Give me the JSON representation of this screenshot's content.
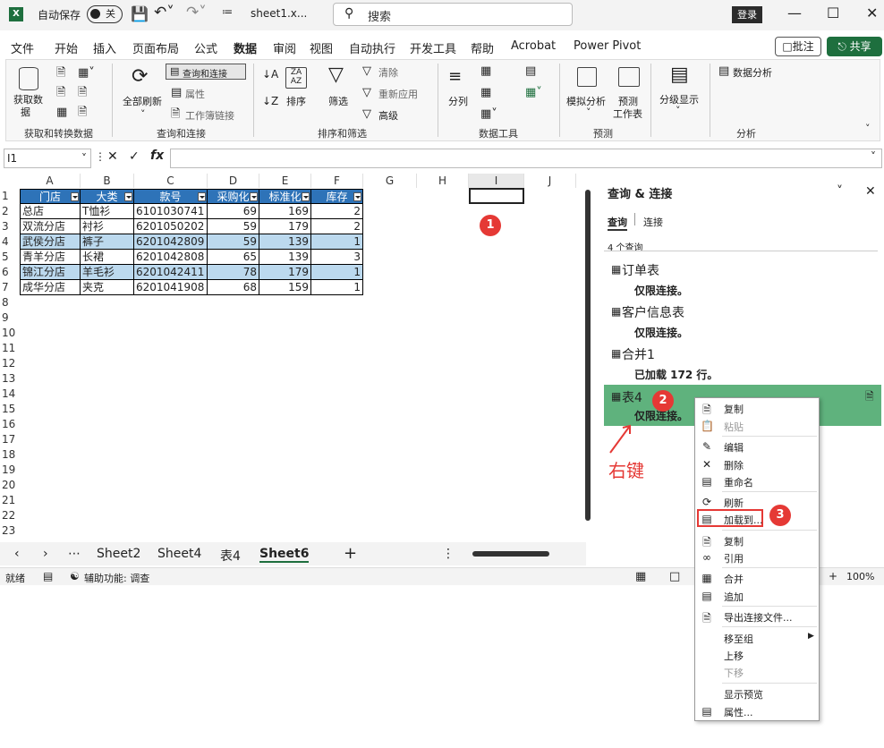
{
  "titlebar": {
    "autosave_label": "自动保存",
    "autosave_state": "关",
    "filename": "sheet1.x...",
    "search_placeholder": "搜索",
    "login": "登录"
  },
  "menu": [
    "文件",
    "开始",
    "插入",
    "页面布局",
    "公式",
    "数据",
    "审阅",
    "视图",
    "自动执行",
    "开发工具",
    "帮助",
    "Acrobat",
    "Power Pivot"
  ],
  "menu_active": "数据",
  "comment_btn": "批注",
  "share_btn": "共享",
  "ribbon": {
    "get_data": "获取数",
    "get_data_2": "据",
    "refresh_all": "全部刷新",
    "queries_connections": "查询和连接",
    "properties": "属性",
    "workbook_links": "工作簿链接",
    "sort": "排序",
    "filter": "筛选",
    "clear": "清除",
    "reapply": "重新应用",
    "advanced": "高级",
    "text_to_columns": "分列",
    "whatif": "模拟分析",
    "forecast": "预测",
    "forecast_2": "工作表",
    "outline": "分级显示",
    "data_analysis": "数据分析",
    "groups": [
      "获取和转换数据",
      "查询和连接",
      "排序和筛选",
      "数据工具",
      "预测",
      "分析"
    ]
  },
  "namebox": "I1",
  "columns": [
    "A",
    "B",
    "C",
    "D",
    "E",
    "F",
    "G",
    "H",
    "I",
    "J"
  ],
  "rows": [
    "1",
    "2",
    "3",
    "4",
    "5",
    "6",
    "7",
    "8",
    "9",
    "10",
    "11",
    "12",
    "13",
    "14",
    "15",
    "16",
    "17",
    "18",
    "19",
    "20",
    "21",
    "22",
    "23"
  ],
  "table": {
    "headers": [
      "门店",
      "大类",
      "款号",
      "采购价",
      "标准价",
      "库存"
    ],
    "header_display": [
      "门店",
      "大类",
      "款号",
      "采购化",
      "标准化",
      "库存"
    ],
    "rows": [
      [
        "总店",
        "T恤衫",
        "6101030741",
        "69",
        "169",
        "2"
      ],
      [
        "双流分店",
        "衬衫",
        "6201050202",
        "59",
        "179",
        "2"
      ],
      [
        "武侯分店",
        "裤子",
        "6201042809",
        "59",
        "139",
        "1"
      ],
      [
        "青羊分店",
        "长裙",
        "6201042808",
        "65",
        "139",
        "3"
      ],
      [
        "锦江分店",
        "羊毛衫",
        "6201042411",
        "78",
        "179",
        "1"
      ],
      [
        "成华分店",
        "夹克",
        "6201041908",
        "68",
        "159",
        "1"
      ]
    ]
  },
  "sheets": [
    "Sheet2",
    "Sheet4",
    "表4",
    "Sheet6"
  ],
  "active_sheet": "Sheet6",
  "status": {
    "ready": "就绪",
    "accessibility": "辅助功能: 调查",
    "zoom": "100%"
  },
  "panel": {
    "title": "查询 & 连接",
    "tab_queries": "查询",
    "tab_connections": "连接",
    "count": "4 个查询",
    "queries": [
      {
        "name": "订单表",
        "status": "仅限连接。"
      },
      {
        "name": "客户信息表",
        "status": "仅限连接。"
      },
      {
        "name": "合并1",
        "status": "已加载 172 行。"
      },
      {
        "name": "表4",
        "status": "仅限连接。"
      }
    ]
  },
  "context_menu": [
    "复制",
    "粘贴",
    "编辑",
    "删除",
    "重命名",
    "刷新",
    "加载到...",
    "复制",
    "引用",
    "合并",
    "追加",
    "导出连接文件...",
    "移至组",
    "上移",
    "下移",
    "显示预览",
    "属性..."
  ],
  "annotation": "右键",
  "badges": [
    "1",
    "2",
    "3"
  ],
  "colors": {
    "accent": "#217346",
    "table_header": "#2e73b8",
    "band": "#bcd9ee",
    "badge": "#e53935",
    "highlight": "#5fb27d"
  }
}
